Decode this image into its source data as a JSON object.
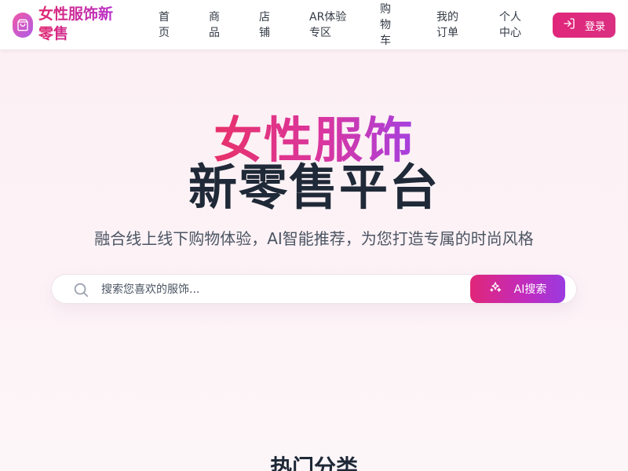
{
  "brand": {
    "name": "女性服饰新零售",
    "icon": "shopping-bag-icon"
  },
  "nav": {
    "items": [
      {
        "label": "首页"
      },
      {
        "label": "商品"
      },
      {
        "label": "店铺"
      },
      {
        "label": "AR体验专区"
      },
      {
        "label": "购物车"
      },
      {
        "label": "我的订单"
      },
      {
        "label": "个人中心"
      }
    ],
    "login_label": "登录",
    "login_icon": "login-icon"
  },
  "hero": {
    "title_line1": "女性服饰",
    "title_line2": "新零售平台",
    "subtitle": "融合线上线下购物体验，AI智能推荐，为您打造专属的时尚风格"
  },
  "search": {
    "placeholder": "搜索您喜欢的服饰...",
    "button_label": "AI搜索",
    "button_icon": "sparkles-icon"
  },
  "sections": {
    "hot_categories_title": "热门分类"
  },
  "colors": {
    "accent_pink": "#e0267a",
    "accent_purple": "#9a3ae0",
    "hero_bg": "#fcf0f4"
  }
}
